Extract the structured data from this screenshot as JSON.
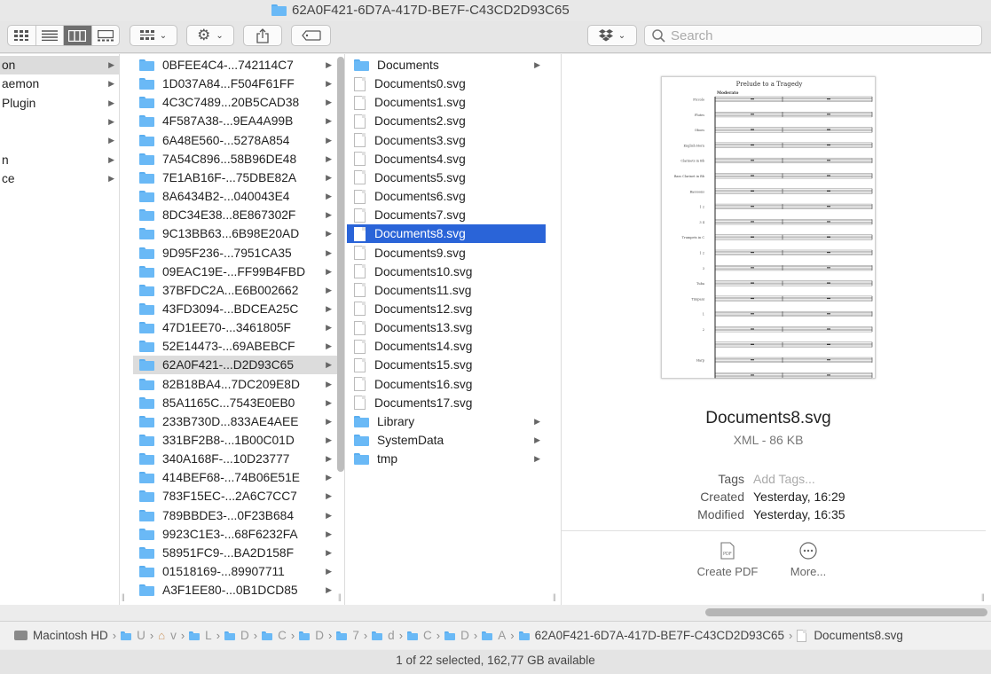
{
  "window": {
    "title": "62A0F421-6D7A-417D-BE7F-C43CD2D93C65"
  },
  "toolbar": {
    "view_modes": [
      "icon-view",
      "list-view",
      "column-view",
      "gallery-view"
    ],
    "active_view": "column-view",
    "search_placeholder": "Search"
  },
  "col1": {
    "items": [
      {
        "label": "on",
        "selected": true,
        "has_children": true
      },
      {
        "label": "aemon",
        "has_children": true
      },
      {
        "label": "Plugin",
        "has_children": true
      },
      {
        "label": "",
        "has_children": true
      },
      {
        "label": "",
        "has_children": true
      },
      {
        "label": "n",
        "has_children": true
      },
      {
        "label": "ce",
        "has_children": true
      }
    ]
  },
  "col2": {
    "items": [
      {
        "label": "0BFEE4C4-...742114C7"
      },
      {
        "label": "1D037A84...F504F61FF"
      },
      {
        "label": "4C3C7489...20B5CAD38"
      },
      {
        "label": "4F587A38-...9EA4A99B"
      },
      {
        "label": "6A48E560-...5278A854"
      },
      {
        "label": "7A54C896...58B96DE48"
      },
      {
        "label": "7E1AB16F-...75DBE82A"
      },
      {
        "label": "8A6434B2-...040043E4"
      },
      {
        "label": "8DC34E38...8E867302F"
      },
      {
        "label": "9C13BB63...6B98E20AD"
      },
      {
        "label": "9D95F236-...7951CA35"
      },
      {
        "label": "09EAC19E-...FF99B4FBD"
      },
      {
        "label": "37BFDC2A...E6B002662"
      },
      {
        "label": "43FD3094-...BDCEA25C"
      },
      {
        "label": "47D1EE70-...3461805F"
      },
      {
        "label": "52E14473-...69ABEBCF"
      },
      {
        "label": "62A0F421-...D2D93C65",
        "selected": true
      },
      {
        "label": "82B18BA4...7DC209E8D"
      },
      {
        "label": "85A1165C...7543E0EB0"
      },
      {
        "label": "233B730D...833AE4AEE"
      },
      {
        "label": "331BF2B8-...1B00C01D"
      },
      {
        "label": "340A168F-...10D23777"
      },
      {
        "label": "414BEF68-...74B06E51E"
      },
      {
        "label": "783F15EC-...2A6C7CC7"
      },
      {
        "label": "789BBDE3-...0F23B684"
      },
      {
        "label": "9923C1E3-...68F6232FA"
      },
      {
        "label": "58951FC9-...BA2D158F"
      },
      {
        "label": "01518169-...89907711"
      },
      {
        "label": "A3F1EE80-...0B1DCD85"
      }
    ]
  },
  "col3": {
    "items": [
      {
        "label": "Documents",
        "type": "folder"
      },
      {
        "label": "Documents0.svg",
        "type": "file"
      },
      {
        "label": "Documents1.svg",
        "type": "file"
      },
      {
        "label": "Documents2.svg",
        "type": "file"
      },
      {
        "label": "Documents3.svg",
        "type": "file"
      },
      {
        "label": "Documents4.svg",
        "type": "file"
      },
      {
        "label": "Documents5.svg",
        "type": "file"
      },
      {
        "label": "Documents6.svg",
        "type": "file"
      },
      {
        "label": "Documents7.svg",
        "type": "file"
      },
      {
        "label": "Documents8.svg",
        "type": "file",
        "highlighted": true
      },
      {
        "label": "Documents9.svg",
        "type": "file"
      },
      {
        "label": "Documents10.svg",
        "type": "file"
      },
      {
        "label": "Documents11.svg",
        "type": "file"
      },
      {
        "label": "Documents12.svg",
        "type": "file"
      },
      {
        "label": "Documents13.svg",
        "type": "file"
      },
      {
        "label": "Documents14.svg",
        "type": "file"
      },
      {
        "label": "Documents15.svg",
        "type": "file"
      },
      {
        "label": "Documents16.svg",
        "type": "file"
      },
      {
        "label": "Documents17.svg",
        "type": "file"
      },
      {
        "label": "Library",
        "type": "folder"
      },
      {
        "label": "SystemData",
        "type": "folder"
      },
      {
        "label": "tmp",
        "type": "folder"
      }
    ]
  },
  "preview": {
    "score_title": "Prelude to a Tragedy",
    "tempo": "Moderato",
    "instruments": [
      "Piccolo",
      "Flutes",
      "Oboes",
      "English Horn",
      "Clarinets in Bb",
      "Bass Clarinet in Bb",
      "Bassoons",
      "1 2",
      "3 4",
      "Trumpets in C",
      "1 2",
      "3",
      "Tuba",
      "Timpani",
      "1",
      "2",
      "",
      "Harp",
      ""
    ],
    "filename": "Documents8.svg",
    "kind": "XML - 86 KB",
    "tags_label": "Tags",
    "tags_placeholder": "Add Tags...",
    "created_label": "Created",
    "created_value": "Yesterday, 16:29",
    "modified_label": "Modified",
    "modified_value": "Yesterday, 16:35",
    "create_pdf": "Create PDF",
    "more": "More..."
  },
  "pathbar": {
    "crumbs": [
      {
        "label": "Macintosh HD",
        "icon": "disk"
      },
      {
        "label": "U",
        "icon": "folder"
      },
      {
        "label": "v",
        "icon": "home"
      },
      {
        "label": "L",
        "icon": "folder"
      },
      {
        "label": "D",
        "icon": "folder"
      },
      {
        "label": "C",
        "icon": "folder"
      },
      {
        "label": "D",
        "icon": "folder"
      },
      {
        "label": "7",
        "icon": "folder"
      },
      {
        "label": "d",
        "icon": "folder"
      },
      {
        "label": "C",
        "icon": "folder"
      },
      {
        "label": "D",
        "icon": "folder"
      },
      {
        "label": "A",
        "icon": "folder"
      },
      {
        "label": "62A0F421-6D7A-417D-BE7F-C43CD2D93C65",
        "icon": "folder"
      },
      {
        "label": "Documents8.svg",
        "icon": "file"
      }
    ]
  },
  "status": {
    "text": "1 of 22 selected, 162,77 GB available"
  },
  "colors": {
    "selection": "#2a64d8",
    "folder": "#6ab9f6"
  }
}
